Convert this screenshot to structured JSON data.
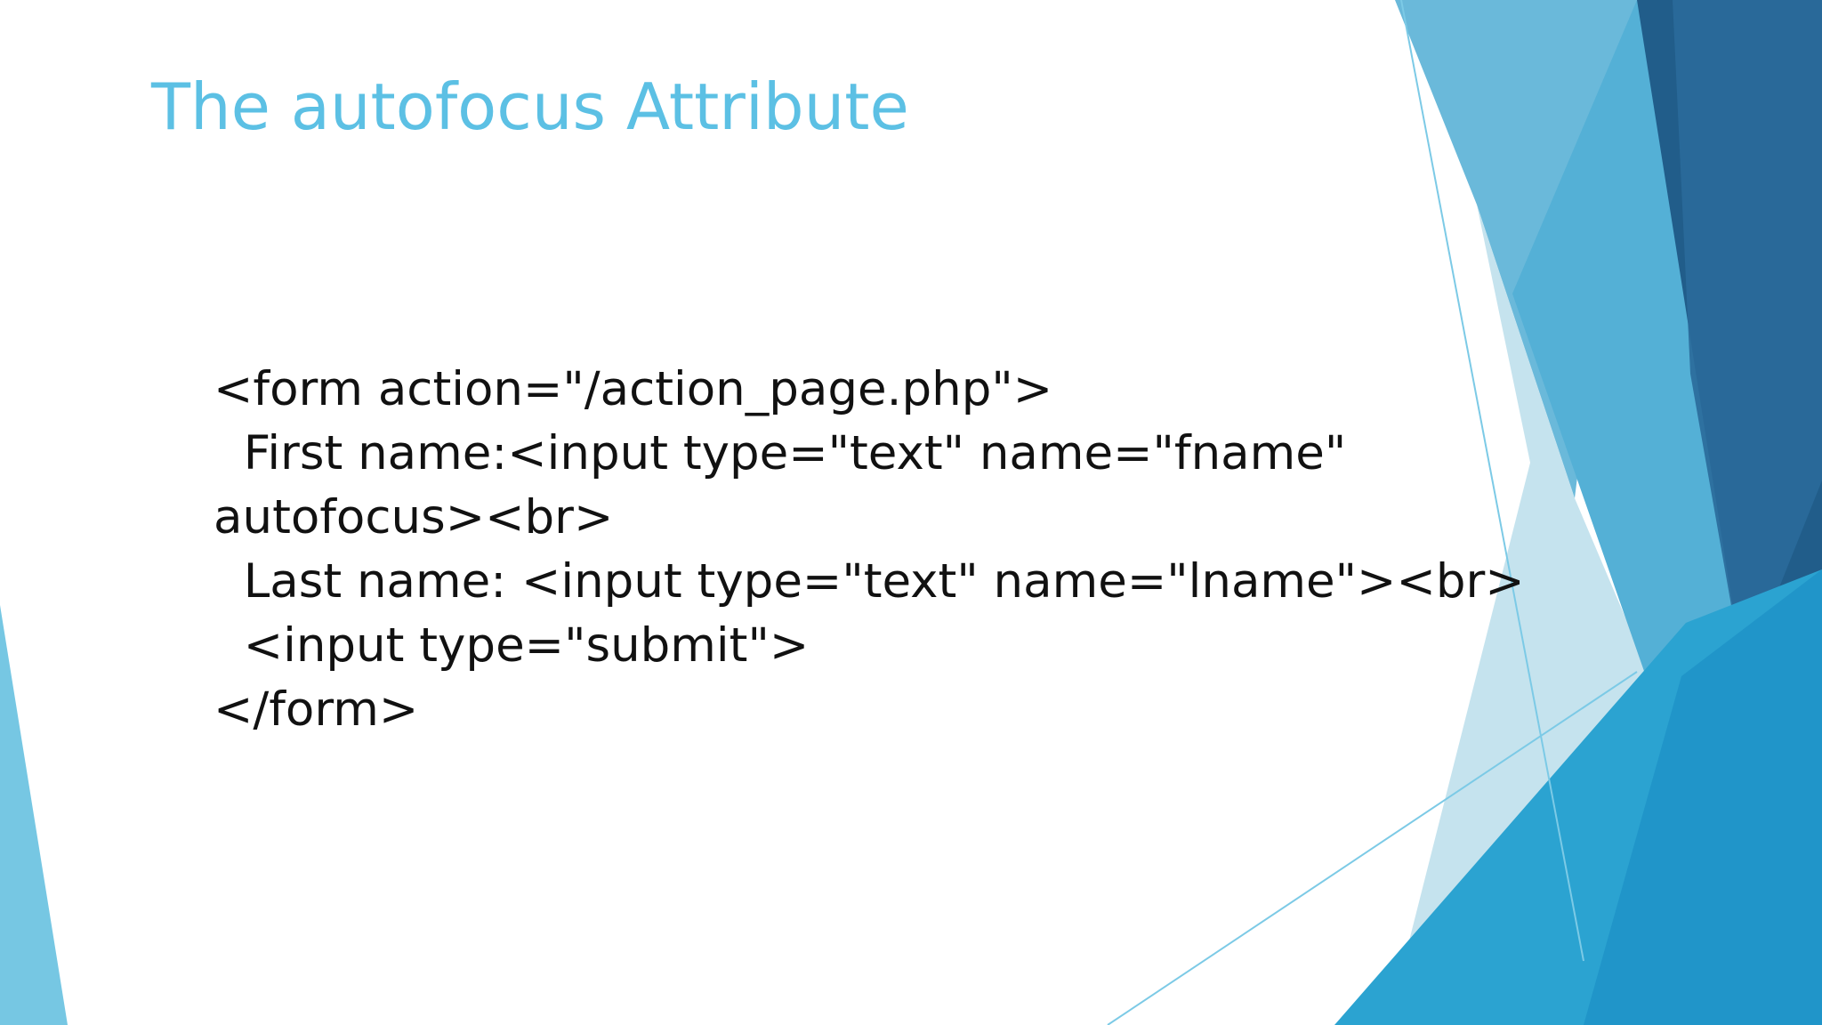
{
  "slide": {
    "title": "The autofocus Attribute",
    "code_lines": [
      "<form action=\"/action_page.php\">",
      "  First name:<input type=\"text\" name=\"fname\"",
      "autofocus><br>",
      "  Last name: <input type=\"text\" name=\"lname\"><br>",
      "  <input type=\"submit\">",
      "</form>"
    ]
  },
  "colors": {
    "title": "#5cc0e4",
    "body_text": "#111111",
    "accent_light": "#6ec3e0",
    "accent_mid": "#2aa4d2",
    "accent_dark": "#215d8a"
  }
}
